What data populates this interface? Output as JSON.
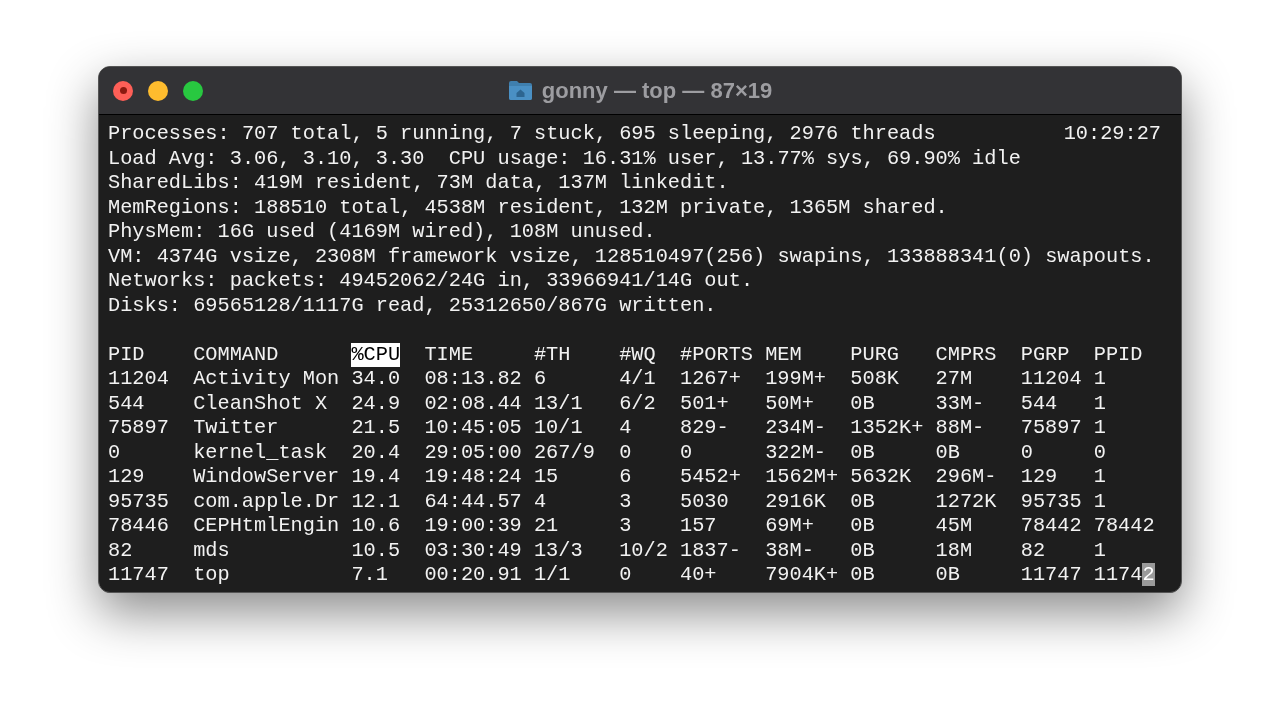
{
  "window": {
    "title": "gonny — top — 87×19"
  },
  "summary": {
    "lines": [
      "Processes: 707 total, 5 running, 7 stuck, 695 sleeping, 2976 threads",
      "Load Avg: 3.06, 3.10, 3.30  CPU usage: 16.31% user, 13.77% sys, 69.90% idle",
      "SharedLibs: 419M resident, 73M data, 137M linkedit.",
      "MemRegions: 188510 total, 4538M resident, 132M private, 1365M shared.",
      "PhysMem: 16G used (4169M wired), 108M unused.",
      "VM: 4374G vsize, 2308M framework vsize, 128510497(256) swapins, 133888341(0) swapouts.",
      "Networks: packets: 49452062/24G in, 33966941/14G out.",
      "Disks: 69565128/1117G read, 25312650/867G written."
    ],
    "clock": "10:29:27"
  },
  "table": {
    "columns": [
      {
        "label": "PID",
        "selected": false
      },
      {
        "label": "COMMAND",
        "selected": false
      },
      {
        "label": "%CPU",
        "selected": true
      },
      {
        "label": "TIME",
        "selected": false
      },
      {
        "label": "#TH",
        "selected": false
      },
      {
        "label": "#WQ",
        "selected": false
      },
      {
        "label": "#PORTS",
        "selected": false
      },
      {
        "label": "MEM",
        "selected": false
      },
      {
        "label": "PURG",
        "selected": false
      },
      {
        "label": "CMPRS",
        "selected": false
      },
      {
        "label": "PGRP",
        "selected": false
      },
      {
        "label": "PPID",
        "selected": false
      }
    ],
    "rows": [
      {
        "cursor": false,
        "cells": [
          "11204",
          "Activity Mon",
          "34.0",
          "08:13.82",
          "6",
          "4/1",
          "1267+",
          "199M+",
          "508K",
          "27M",
          "11204",
          "1"
        ]
      },
      {
        "cursor": false,
        "cells": [
          "544",
          "CleanShot X",
          "24.9",
          "02:08.44",
          "13/1",
          "6/2",
          "501+",
          "50M+",
          "0B",
          "33M-",
          "544",
          "1"
        ]
      },
      {
        "cursor": false,
        "cells": [
          "75897",
          "Twitter",
          "21.5",
          "10:45:05",
          "10/1",
          "4",
          "829-",
          "234M-",
          "1352K+",
          "88M-",
          "75897",
          "1"
        ]
      },
      {
        "cursor": false,
        "cells": [
          "0",
          "kernel_task",
          "20.4",
          "29:05:00",
          "267/9",
          "0",
          "0",
          "322M-",
          "0B",
          "0B",
          "0",
          "0"
        ]
      },
      {
        "cursor": false,
        "cells": [
          "129",
          "WindowServer",
          "19.4",
          "19:48:24",
          "15",
          "6",
          "5452+",
          "1562M+",
          "5632K",
          "296M-",
          "129",
          "1"
        ]
      },
      {
        "cursor": false,
        "cells": [
          "95735",
          "com.apple.Dr",
          "12.1",
          "64:44.57",
          "4",
          "3",
          "5030",
          "2916K",
          "0B",
          "1272K",
          "95735",
          "1"
        ]
      },
      {
        "cursor": false,
        "cells": [
          "78446",
          "CEPHtmlEngin",
          "10.6",
          "19:00:39",
          "21",
          "3",
          "157",
          "69M+",
          "0B",
          "45M",
          "78442",
          "78442"
        ]
      },
      {
        "cursor": false,
        "cells": [
          "82",
          "mds",
          "10.5",
          "03:30:49",
          "13/3",
          "10/2",
          "1837-",
          "38M-",
          "0B",
          "18M",
          "82",
          "1"
        ]
      },
      {
        "cursor": true,
        "cells": [
          "11747",
          "top",
          "7.1",
          "00:20.91",
          "1/1",
          "0",
          "40+",
          "7904K+",
          "0B",
          "0B",
          "11747",
          "11742"
        ]
      }
    ]
  }
}
